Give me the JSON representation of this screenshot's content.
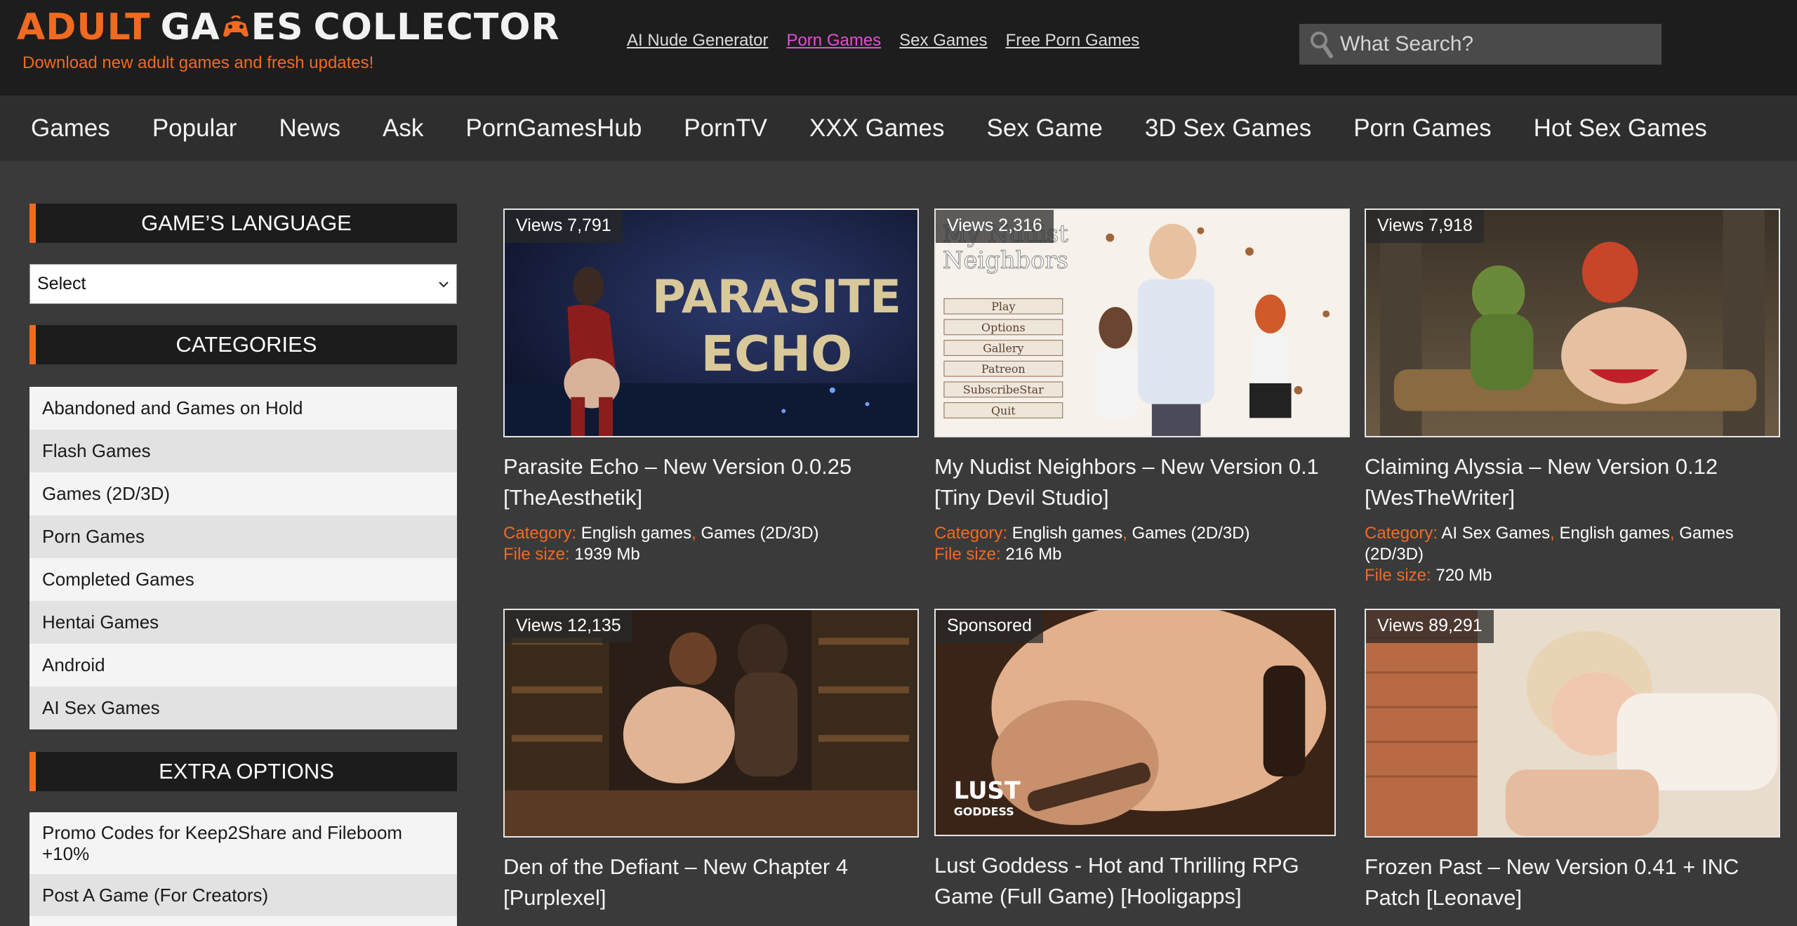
{
  "header": {
    "logo": {
      "word1": "ADULT",
      "word2a": "GA",
      "word2b": "ES",
      "word3": "COLLECTOR"
    },
    "tagline": "Download new adult games and fresh updates!",
    "links": [
      {
        "label": "AI Nude Generator",
        "active": false
      },
      {
        "label": "Porn Games",
        "active": true
      },
      {
        "label": "Sex Games",
        "active": false
      },
      {
        "label": "Free Porn Games",
        "active": false
      }
    ],
    "search_placeholder": "What Search?"
  },
  "nav": [
    "Games",
    "Popular",
    "News",
    "Ask",
    "PornGamesHub",
    "PornTV",
    "XXX Games",
    "Sex Game",
    "3D Sex Games",
    "Porn Games",
    "Hot Sex Games"
  ],
  "sidebar": {
    "language_title": "GAME’S LANGUAGE",
    "language_select": "Select",
    "categories_title": "CATEGORIES",
    "categories": [
      "Abandoned and Games on Hold",
      "Flash Games",
      "Games (2D/3D)",
      "Porn Games",
      "Completed Games",
      "Hentai Games",
      "Android",
      "AI Sex Games"
    ],
    "extra_title": "EXTRA OPTIONS",
    "extra": [
      "Promo Codes for Keep2Share and Fileboom +10%",
      "Post A Game (For Creators)"
    ]
  },
  "labels": {
    "category": "Category:",
    "file_size": "File size:"
  },
  "cards": [
    {
      "badge": "Views 7,791",
      "title": "Parasite Echo – New Version 0.0.25 [TheAesthetik]",
      "categories": [
        "English games",
        "Games (2D/3D)"
      ],
      "file_size": "1939 Mb",
      "art_text1": "PARASITE",
      "art_text2": "ECHO"
    },
    {
      "badge": "Views 2,316",
      "title": "My Nudist Neighbors – New Version 0.1 [Tiny Devil Studio]",
      "categories": [
        "English games",
        "Games (2D/3D)"
      ],
      "file_size": "216 Mb",
      "art_text1": "My Nudist",
      "art_text2": "Neighbors",
      "menu": [
        "Play",
        "Options",
        "Gallery",
        "Patreon",
        "SubscribeStar",
        "Quit"
      ]
    },
    {
      "badge": "Views 7,918",
      "title": "Claiming Alyssia – New Version 0.12 [WesTheWriter]",
      "categories": [
        "AI Sex Games",
        "English games",
        "Games (2D/3D)"
      ],
      "file_size": "720 Mb"
    },
    {
      "badge": "Views 12,135",
      "title": "Den of the Defiant – New Chapter 4 [Purplexel]"
    },
    {
      "badge": "Sponsored",
      "title": "Lust Goddess - Hot and Thrilling RPG Game (Full Game) [Hooligapps]",
      "art_text1": "LUST",
      "art_text2": "GODDESS"
    },
    {
      "badge": "Views 89,291",
      "title": "Frozen Past – New Version 0.41 + INC Patch [Leonave]"
    }
  ],
  "colors": {
    "accent": "#f26a21",
    "active_link": "#e14fd6",
    "header_bg": "#1d1d1d",
    "nav_bg": "#2e2e2e",
    "page_bg": "#3a3a3a"
  }
}
